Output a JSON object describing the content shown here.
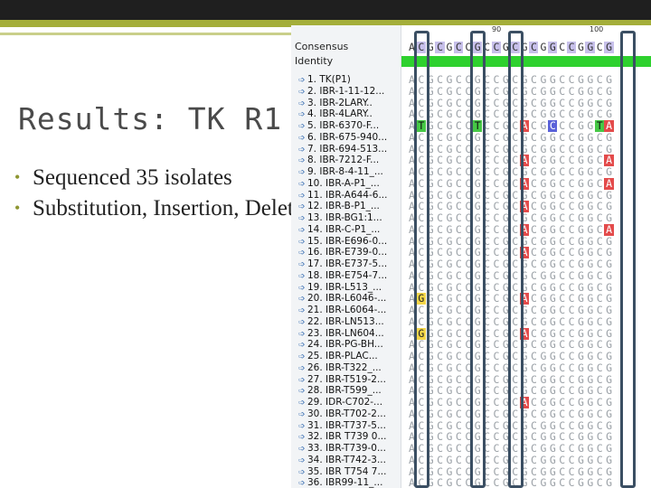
{
  "slide": {
    "title": "Results: TK R1",
    "bullets": [
      "Sequenced 35 isolates",
      "Substitution, Insertion, Deletion"
    ]
  },
  "alignment": {
    "header": {
      "consensus_label": "Consensus",
      "identity_label": "Identity",
      "ruler_marks": [
        "90",
        "100"
      ]
    },
    "consensus": "ACGCGCCGCCGCGCGGCCGGCG",
    "sequences": [
      {
        "label": "1. TK(P1)"
      },
      {
        "label": "2. IBR-1-11-12..."
      },
      {
        "label": "3. IBR-2LARY.."
      },
      {
        "label": "4. IBR-4LARY.."
      },
      {
        "label": "5. IBR-6370-F..."
      },
      {
        "label": "6. IBR-675-940..."
      },
      {
        "label": "7. IBR-694-513..."
      },
      {
        "label": "8. IBR-7212-F..."
      },
      {
        "label": "9. IBR-8-4-11_..."
      },
      {
        "label": "10. IBR-A-P1_..."
      },
      {
        "label": "11. IBR-A644-6..."
      },
      {
        "label": "12. IBR-B-P1_..."
      },
      {
        "label": "13. IBR-BG1:1..."
      },
      {
        "label": "14. IBR-C-P1_..."
      },
      {
        "label": "15. IBR-E696-0..."
      },
      {
        "label": "16. IBR-E739-0..."
      },
      {
        "label": "17. IBR-E737-5..."
      },
      {
        "label": "18. IBR-E754-7..."
      },
      {
        "label": "19. IBR-L513_..."
      },
      {
        "label": "20. IBR-L6046-..."
      },
      {
        "label": "21. IBR-L6064-..."
      },
      {
        "label": "22. IBR-LN513..."
      },
      {
        "label": "23. IBR-LN604..."
      },
      {
        "label": "24. IBR-PG-BH..."
      },
      {
        "label": "25. IBR-PLAC..."
      },
      {
        "label": "26. IBR-T322_..."
      },
      {
        "label": "27. IBR-T519-2..."
      },
      {
        "label": "28. IBR-T599_..."
      },
      {
        "label": "29. IDR-C702-..."
      },
      {
        "label": "30. IBR-T702-2..."
      },
      {
        "label": "31. IBR-T737-5..."
      },
      {
        "label": "32. IBR T739 0..."
      },
      {
        "label": "33. IBR-T739-0..."
      },
      {
        "label": "34. IBR-T742-3..."
      },
      {
        "label": "35. IBR T754 7..."
      },
      {
        "label": "36. IBR99-11_..."
      }
    ],
    "variants": [
      {
        "row": 5,
        "col": 1,
        "base": "T",
        "color": "green"
      },
      {
        "row": 5,
        "col": 7,
        "base": "T",
        "color": "green"
      },
      {
        "row": 5,
        "col": 12,
        "base": "A",
        "color": "red"
      },
      {
        "row": 5,
        "col": 15,
        "base": "C",
        "color": "blue"
      },
      {
        "row": 5,
        "col": 20,
        "base": "T",
        "color": "green"
      },
      {
        "row": 5,
        "col": 21,
        "base": "A",
        "color": "red"
      },
      {
        "row": 8,
        "col": 12,
        "base": "A",
        "color": "red"
      },
      {
        "row": 8,
        "col": 21,
        "base": "A",
        "color": "red"
      },
      {
        "row": 10,
        "col": 12,
        "base": "A",
        "color": "red"
      },
      {
        "row": 10,
        "col": 21,
        "base": "A",
        "color": "red"
      },
      {
        "row": 12,
        "col": 12,
        "base": "A",
        "color": "red"
      },
      {
        "row": 14,
        "col": 12,
        "base": "A",
        "color": "red"
      },
      {
        "row": 14,
        "col": 21,
        "base": "A",
        "color": "red"
      },
      {
        "row": 16,
        "col": 12,
        "base": "A",
        "color": "red"
      },
      {
        "row": 20,
        "col": 1,
        "base": "G",
        "color": "yellow"
      },
      {
        "row": 20,
        "col": 12,
        "base": "A",
        "color": "red"
      },
      {
        "row": 23,
        "col": 1,
        "base": "G",
        "color": "yellow"
      },
      {
        "row": 23,
        "col": 12,
        "base": "A",
        "color": "red"
      },
      {
        "row": 29,
        "col": 12,
        "base": "A",
        "color": "red"
      }
    ]
  }
}
